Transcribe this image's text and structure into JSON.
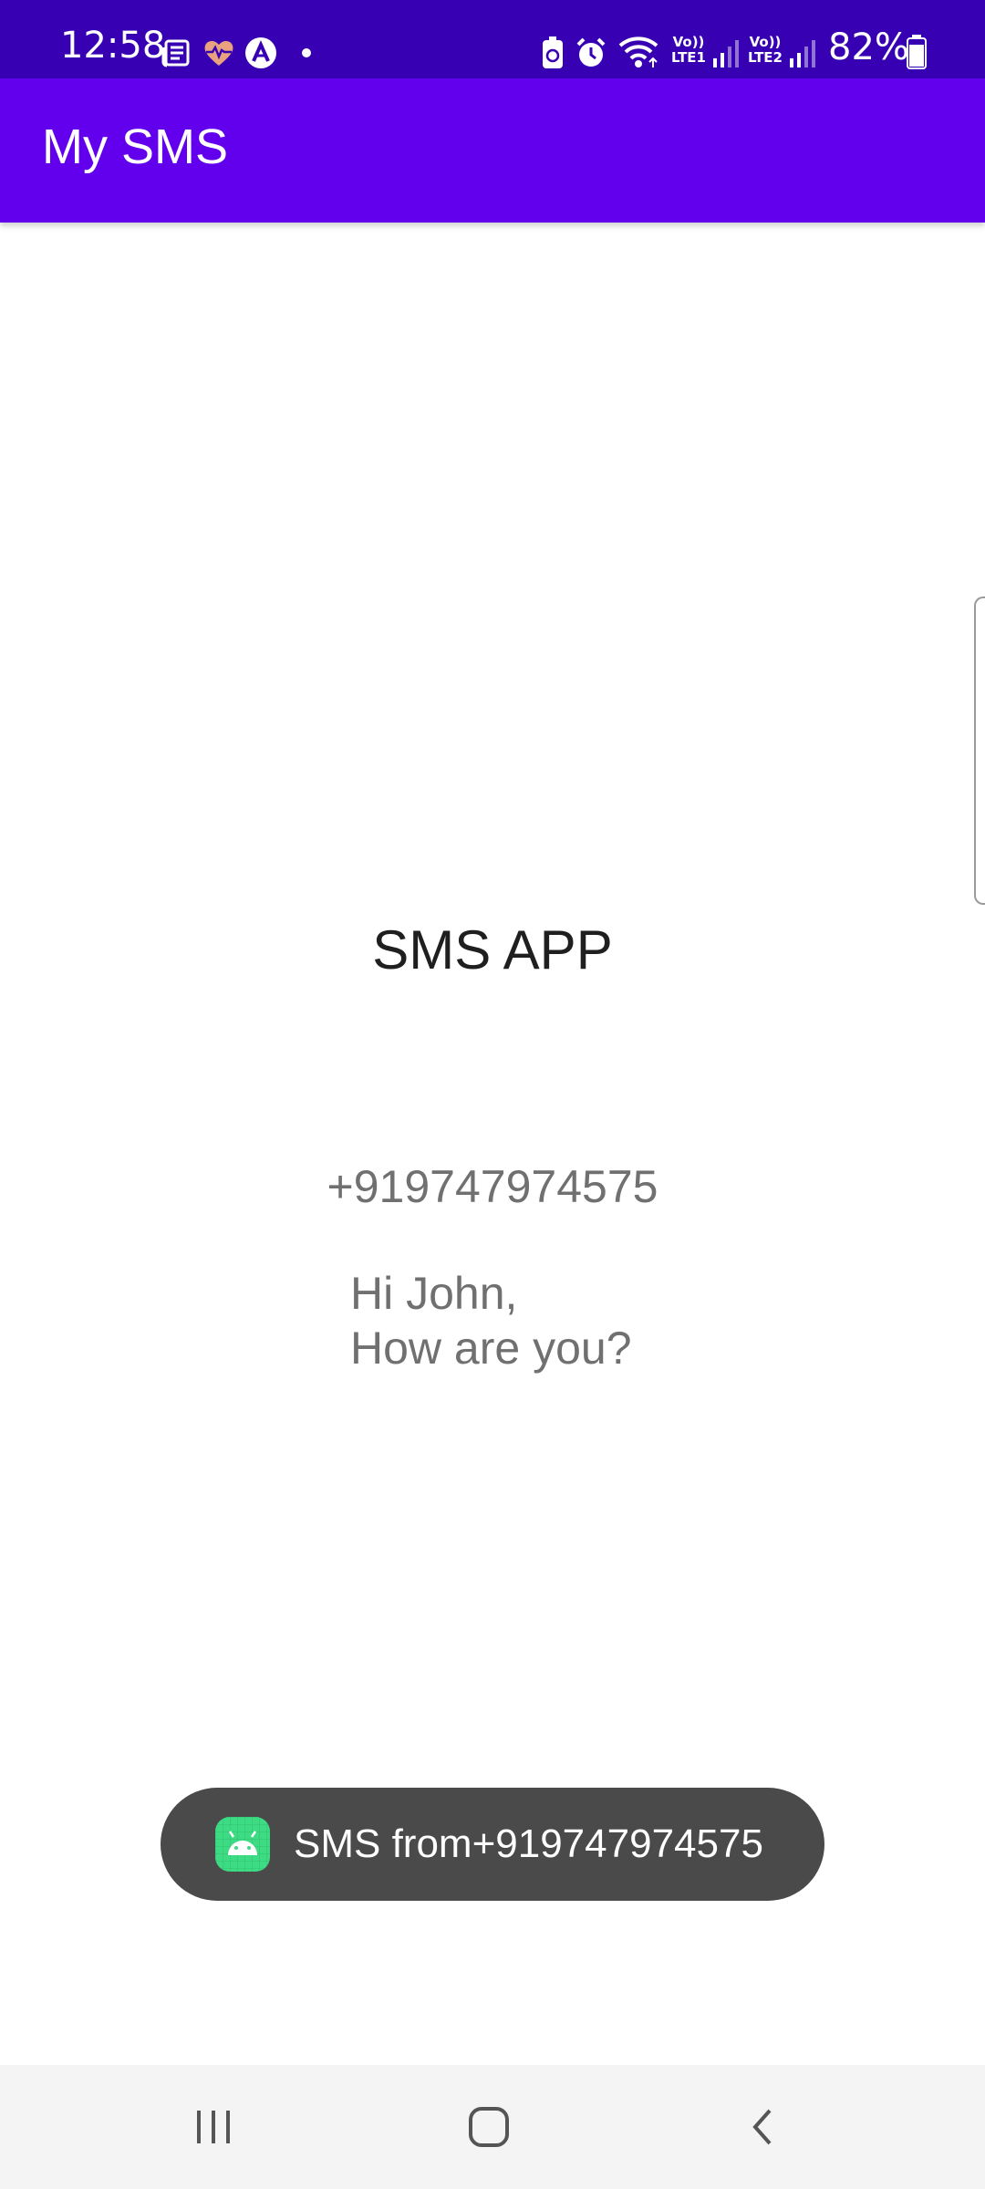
{
  "status_bar": {
    "time": "12:58",
    "battery_percent": "82%",
    "battery_level": 0.82,
    "icons": [
      "news-icon",
      "health-icon",
      "autocorrect-icon",
      "dot-icon",
      "battery-saver-icon",
      "alarm-icon",
      "wifi-icon",
      "volte-lte1-icon",
      "signal-icon",
      "volte-lte2-icon",
      "signal-icon",
      "battery-icon"
    ],
    "sim1_label_top": "Vo))",
    "sim1_label_bottom": "LTE1",
    "sim2_label_top": "Vo))",
    "sim2_label_bottom": "LTE2"
  },
  "app_bar": {
    "title": "My SMS"
  },
  "main": {
    "title": "SMS APP",
    "phone_number": "+919747974575",
    "message_lines": [
      "Hi John,",
      "How are you?"
    ]
  },
  "toast": {
    "text": "SMS from+919747974575",
    "icon": "android-icon"
  },
  "nav_bar": {
    "buttons": [
      "recents-icon",
      "home-icon",
      "back-icon"
    ]
  },
  "colors": {
    "status_bar": "#3700b3",
    "app_bar": "#6200ee",
    "toast_bg": "#4a4a4a",
    "android_green": "#3ddc84"
  }
}
